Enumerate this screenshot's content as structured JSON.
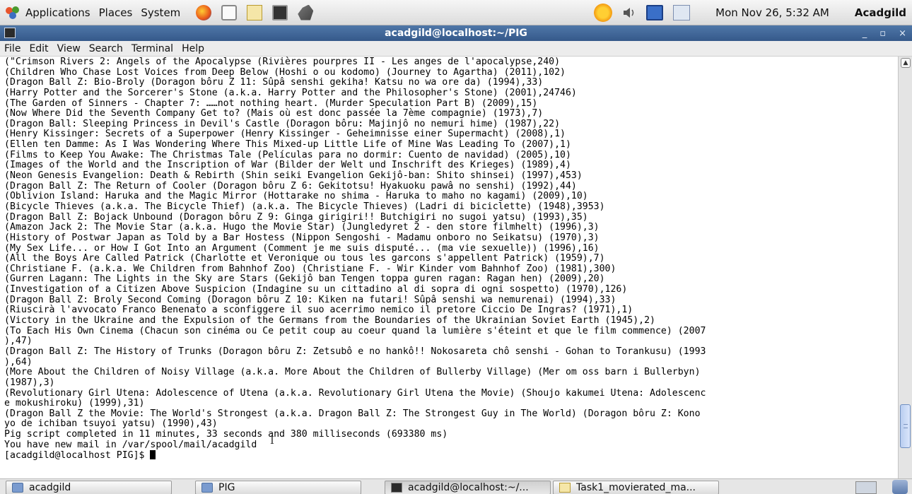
{
  "top_panel": {
    "menus": [
      "Applications",
      "Places",
      "System"
    ],
    "clock": "Mon Nov 26,  5:32 AM",
    "user": "Acadgild"
  },
  "window": {
    "title": "acadgild@localhost:~/PIG",
    "controls": [
      "_",
      "▫",
      "×"
    ]
  },
  "menubar": [
    "File",
    "Edit",
    "View",
    "Search",
    "Terminal",
    "Help"
  ],
  "terminal": {
    "lines": [
      "(\"Crimson Rivers 2: Angels of the Apocalypse (Rivières pourpres II - Les anges de l'apocalypse,240)",
      "(Children Who Chase Lost Voices from Deep Below (Hoshi o ou kodomo) (Journey to Agartha) (2011),102)",
      "(Dragon Ball Z: Bio-Broly (Doragon bôru Z 11: Sûpâ senshi gekiha! Katsu no wa ore da) (1994),33)",
      "(Harry Potter and the Sorcerer's Stone (a.k.a. Harry Potter and the Philosopher's Stone) (2001),24746)",
      "(The Garden of Sinners - Chapter 7: ……not nothing heart. (Murder Speculation Part B) (2009),15)",
      "(Now Where Did the Seventh Company Get to? (Mais où est donc passée la 7ème compagnie) (1973),7)",
      "(Dragon Ball: Sleeping Princess in Devil's Castle (Doragon bôru: Majinjô no nemuri hime) (1987),22)",
      "(Henry Kissinger: Secrets of a Superpower (Henry Kissinger - Geheimnisse einer Supermacht) (2008),1)",
      "(Ellen ten Damme: As I Was Wondering Where This Mixed-up Little Life of Mine Was Leading To (2007),1)",
      "(Films to Keep You Awake: The Christmas Tale (Películas para no dormir: Cuento de navidad) (2005),10)",
      "(Images of the World and the Inscription of War (Bilder der Welt und Inschrift des Krieges) (1989),4)",
      "(Neon Genesis Evangelion: Death & Rebirth (Shin seiki Evangelion Gekijô-ban: Shito shinsei) (1997),453)",
      "(Dragon Ball Z: The Return of Cooler (Doragon bôru Z 6: Gekitotsu! Hyakuoku pawâ no senshi) (1992),44)",
      "(Oblivion Island: Haruka and the Magic Mirror (Hottarake no shima - Haruka to maho no kagami) (2009),10)",
      "(Bicycle Thieves (a.k.a. The Bicycle Thief) (a.k.a. The Bicycle Thieves) (Ladri di biciclette) (1948),3953)",
      "(Dragon Ball Z: Bojack Unbound (Doragon bôru Z 9: Ginga girigiri!! Butchigiri no sugoi yatsu) (1993),35)",
      "(Amazon Jack 2: The Movie Star (a.k.a. Hugo the Movie Star) (Jungledyret 2 - den store filmhelt) (1996),3)",
      "(History of Postwar Japan as Told by a Bar Hostess (Nippon Sengoshi - Madamu onboro no Seikatsu) (1970),3)",
      "(My Sex Life... or How I Got Into an Argument (Comment je me suis disputé... (ma vie sexuelle)) (1996),16)",
      "(All the Boys Are Called Patrick (Charlotte et Veronique ou tous les garcons s'appellent Patrick) (1959),7)",
      "(Christiane F. (a.k.a. We Children from Bahnhof Zoo) (Christiane F. - Wir Kinder vom Bahnhof Zoo) (1981),300)",
      "(Gurren Lagann: The Lights in the Sky are Stars (Gekijô ban Tengen toppa guren ragan: Ragan hen) (2009),20)",
      "(Investigation of a Citizen Above Suspicion (Indagine su un cittadino al di sopra di ogni sospetto) (1970),126)",
      "(Dragon Ball Z: Broly Second Coming (Doragon bôru Z 10: Kiken na futari! Sûpâ senshi wa nemurenai) (1994),33)",
      "(Riuscirà l'avvocato Franco Benenato a sconfiggere il suo acerrimo nemico il pretore Ciccio De Ingras? (1971),1)",
      "(Victory in the Ukraine and the Expulsion of the Germans from the Boundaries of the Ukrainian Soviet Earth (1945),2)",
      "(To Each His Own Cinema (Chacun son cinéma ou Ce petit coup au coeur quand la lumière s'éteint et que le film commence) (2007",
      "),47)",
      "(Dragon Ball Z: The History of Trunks (Doragon bôru Z: Zetsubô e no hankô!! Nokosareta chô senshi - Gohan to Torankusu) (1993",
      "),64)",
      "(More About the Children of Noisy Village (a.k.a. More About the Children of Bullerby Village) (Mer om oss barn i Bullerbyn)",
      "(1987),3)",
      "(Revolutionary Girl Utena: Adolescence of Utena (a.k.a. Revolutionary Girl Utena the Movie) (Shoujo kakumei Utena: Adolescenc",
      "e mokushiroku) (1999),31)",
      "(Dragon Ball Z the Movie: The World's Strongest (a.k.a. Dragon Ball Z: The Strongest Guy in The World) (Doragon bôru Z: Kono",
      "yo de ichiban tsuyoi yatsu) (1990),43)",
      "Pig script completed in 11 minutes, 33 seconds and 380 milliseconds (693380 ms)",
      "You have new mail in /var/spool/mail/acadgild"
    ],
    "prompt": "[acadgild@localhost PIG]$ "
  },
  "scrollbar": {
    "position": 0.95,
    "visible_fraction": 0.11
  },
  "taskbar": {
    "items": [
      "acadgild",
      "PIG",
      "acadgild@localhost:~/...",
      "Task1_movierated_ma..."
    ]
  }
}
